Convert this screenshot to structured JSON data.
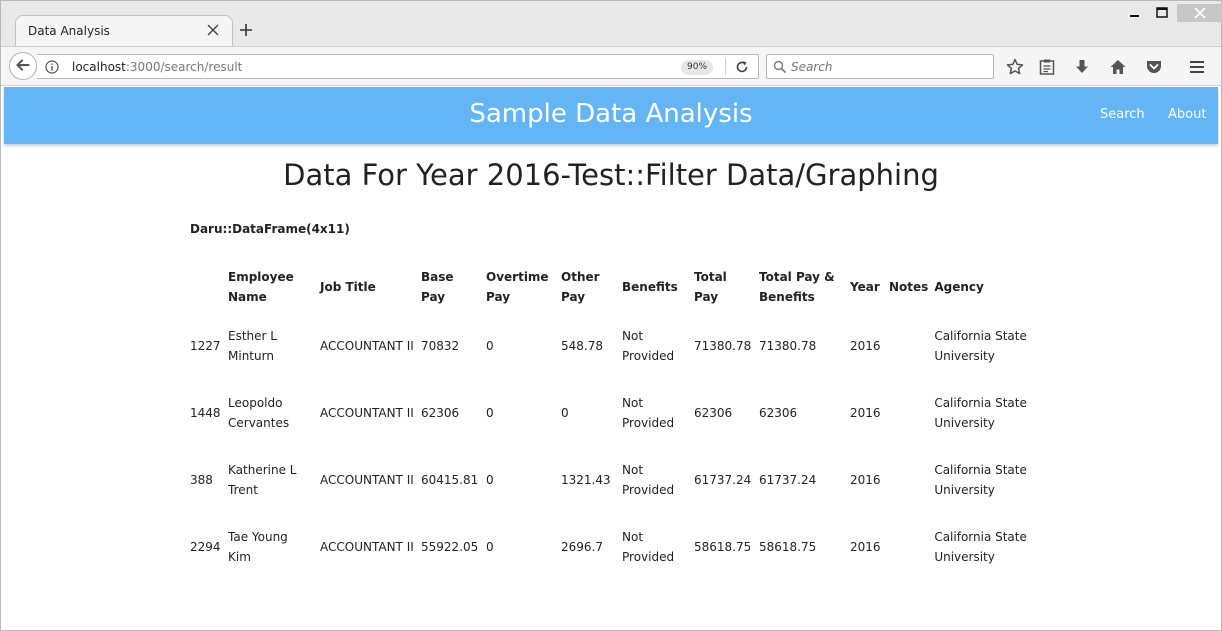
{
  "browser": {
    "tab_title": "Data Analysis",
    "url_host": "localhost",
    "url_path": ":3000/search/result",
    "zoom": "90%",
    "search_placeholder": "Search"
  },
  "app": {
    "title": "Sample Data Analysis",
    "nav": {
      "search": "Search",
      "about": "About"
    }
  },
  "page": {
    "heading": "Data For Year 2016-Test::Filter Data/Graphing",
    "caption": "Daru::DataFrame(4x11)"
  },
  "table": {
    "headers": [
      "",
      "Employee Name",
      "Job Title",
      "Base Pay",
      "Overtime Pay",
      "Other Pay",
      "Benefits",
      "Total Pay",
      "Total Pay & Benefits",
      "Year",
      "Notes",
      "Agency"
    ],
    "rows": [
      [
        "1227",
        "Esther L Minturn",
        "ACCOUNTANT II",
        "70832",
        "0",
        "548.78",
        "Not Provided",
        "71380.78",
        "71380.78",
        "2016",
        "",
        "California State University"
      ],
      [
        "1448",
        "Leopoldo Cervantes",
        "ACCOUNTANT II",
        "62306",
        "0",
        "0",
        "Not Provided",
        "62306",
        "62306",
        "2016",
        "",
        "California State University"
      ],
      [
        "388",
        "Katherine L Trent",
        "ACCOUNTANT II",
        "60415.81",
        "0",
        "1321.43",
        "Not Provided",
        "61737.24",
        "61737.24",
        "2016",
        "",
        "California State University"
      ],
      [
        "2294",
        "Tae Young Kim",
        "ACCOUNTANT II",
        "55922.05",
        "0",
        "2696.7",
        "Not Provided",
        "58618.75",
        "58618.75",
        "2016",
        "",
        "California State University"
      ]
    ]
  },
  "icons": {
    "tab_close": "close-icon",
    "new_tab": "plus-icon",
    "back": "back-arrow-icon",
    "info": "info-icon",
    "reload": "reload-icon",
    "search": "search-icon",
    "bookmark": "star-icon",
    "reading_list": "clipboard-icon",
    "download": "download-icon",
    "home": "home-icon",
    "pocket": "pocket-icon",
    "menu": "hamburger-menu-icon"
  },
  "colors": {
    "header_bg": "#64b5f6",
    "header_text": "#ffffff"
  }
}
